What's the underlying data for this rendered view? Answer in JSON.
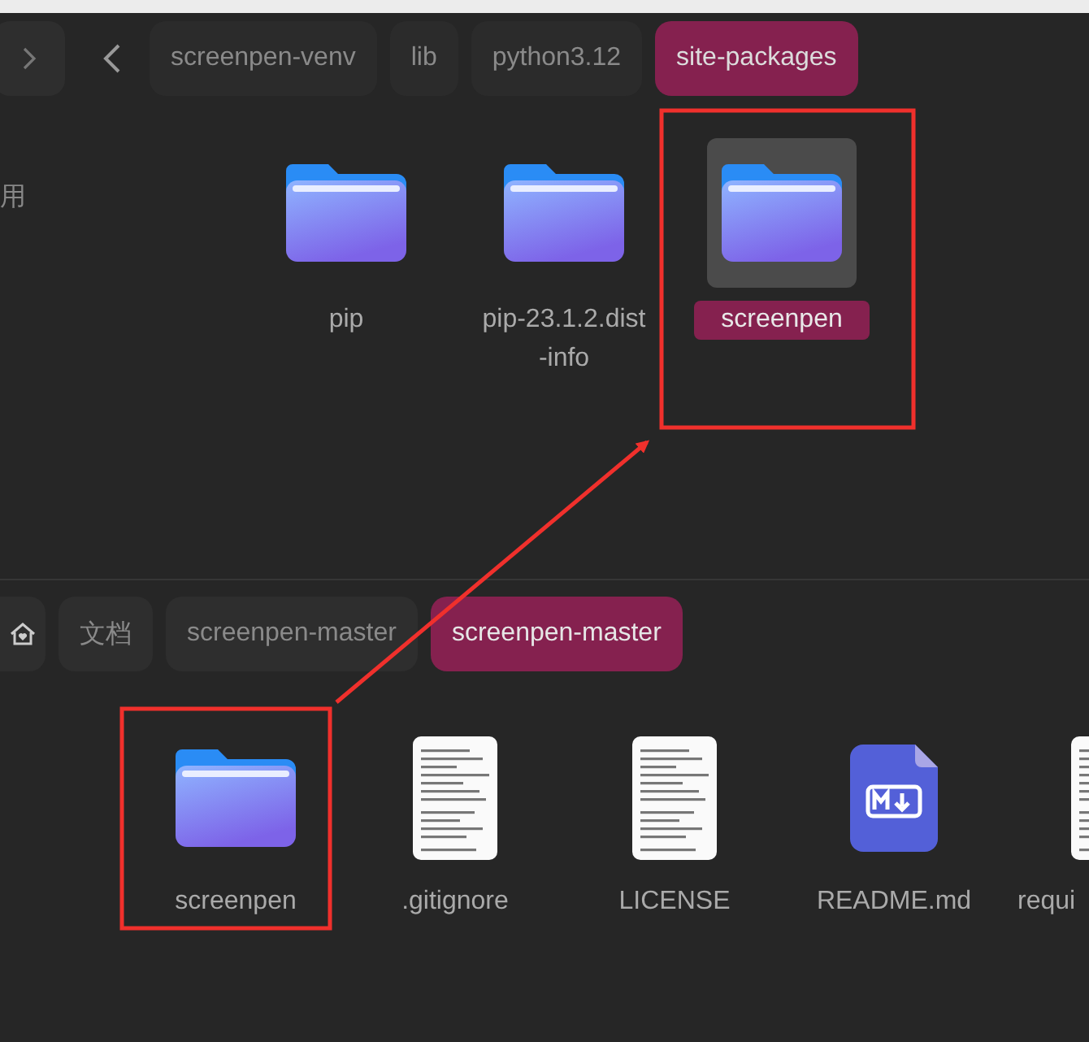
{
  "top_pane": {
    "sidebar_text": "用",
    "breadcrumbs": [
      {
        "label": "screenpen-venv",
        "selected": false
      },
      {
        "label": "lib",
        "selected": false
      },
      {
        "label": "python3.12",
        "selected": false
      },
      {
        "label": "site-packages",
        "selected": true
      }
    ],
    "items": [
      {
        "name": "pip",
        "kind": "folder",
        "selected": false
      },
      {
        "name": "pip-23.1.2.dist-info",
        "kind": "folder",
        "selected": false
      },
      {
        "name": "screenpen",
        "kind": "folder",
        "selected": true
      }
    ]
  },
  "bottom_pane": {
    "breadcrumbs": [
      {
        "kind": "home",
        "selected": false
      },
      {
        "kind": "crumb",
        "label": "文档",
        "selected": false
      },
      {
        "kind": "crumb",
        "label": "screenpen-master",
        "selected": false
      },
      {
        "kind": "crumb",
        "label": "screenpen-master",
        "selected": true
      }
    ],
    "items": [
      {
        "name": "screenpen",
        "kind": "folder",
        "selected": false
      },
      {
        "name": ".gitignore",
        "kind": "text",
        "selected": false
      },
      {
        "name": "LICENSE",
        "kind": "text",
        "selected": false
      },
      {
        "name": "README.md",
        "kind": "markdown",
        "selected": false
      },
      {
        "name": "requi",
        "kind": "text",
        "selected": false
      }
    ]
  }
}
